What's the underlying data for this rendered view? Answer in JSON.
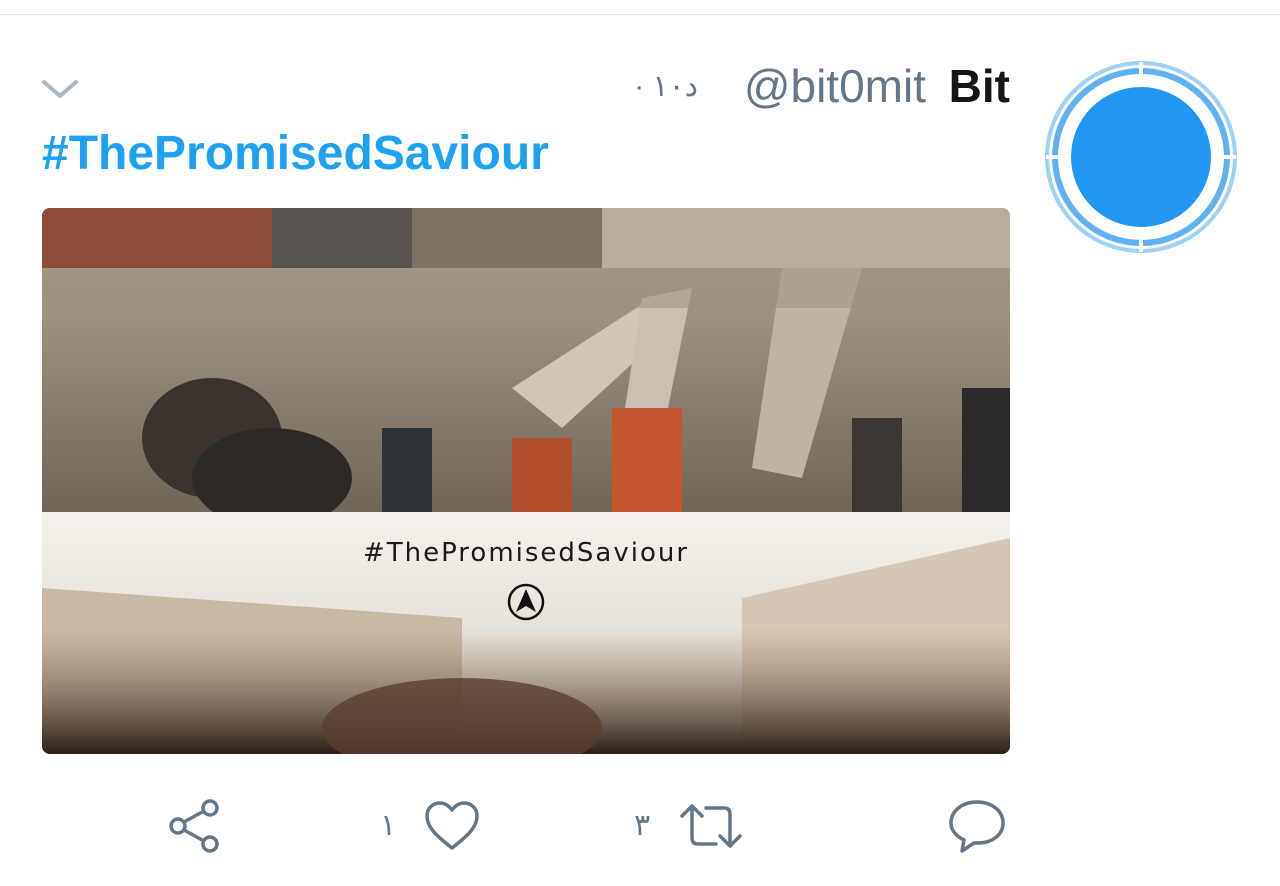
{
  "tweet": {
    "display_name": "Bit",
    "handle": "@bit0mit",
    "timestamp": "۱۰ · ",
    "timestamp_unit": "د",
    "hashtag": "#ThePromisedSaviour",
    "media": {
      "caption": "#ThePromisedSaviour"
    },
    "actions": {
      "like_count": "۱",
      "retweet_count": "۳"
    }
  },
  "colors": {
    "accent": "#1da1f2",
    "avatar_blue": "#2196f3",
    "text_primary": "#14171a",
    "text_secondary": "#657786",
    "icon_gray": "#657786"
  },
  "icons": {
    "caret": "chevron-down-icon",
    "share": "share-icon",
    "like": "heart-icon",
    "retweet": "retweet-icon",
    "reply": "reply-icon"
  }
}
